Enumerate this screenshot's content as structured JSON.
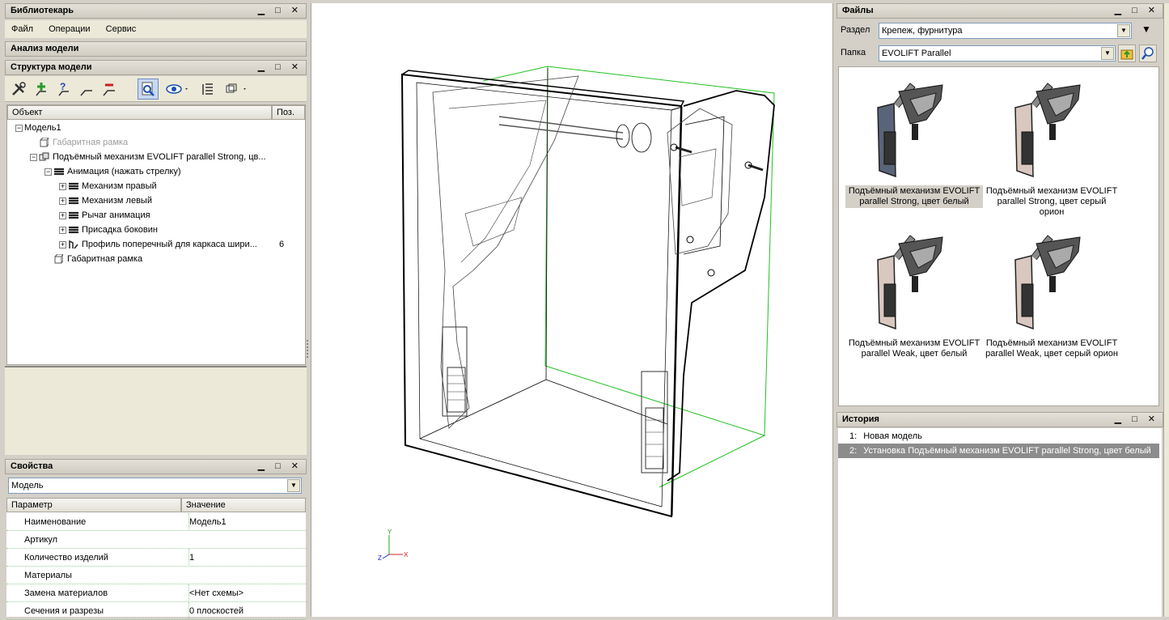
{
  "library": {
    "title": "Библиотекарь",
    "menu": [
      "Файл",
      "Операции",
      "Сервис"
    ]
  },
  "analysis": {
    "title": "Анализ модели"
  },
  "structure": {
    "title": "Структура модели",
    "columns": {
      "object": "Объект",
      "pos": "Поз."
    },
    "tree": [
      {
        "label": "Модель1",
        "level": 0,
        "expander": "−",
        "icon": "none"
      },
      {
        "label": "Габаритная рамка",
        "level": 1,
        "expander": "",
        "icon": "frame-icon",
        "dim": true
      },
      {
        "label": "Подъёмный механизм EVOLIFT parallel Strong, цв...",
        "level": 1,
        "expander": "−",
        "icon": "assembly-icon"
      },
      {
        "label": "Анимация (нажать стрелку)",
        "level": 2,
        "expander": "−",
        "icon": "stack-icon"
      },
      {
        "label": "Механизм правый",
        "level": 3,
        "expander": "+",
        "icon": "stack-icon"
      },
      {
        "label": "Механизм левый",
        "level": 3,
        "expander": "+",
        "icon": "stack-icon"
      },
      {
        "label": "Рычаг анимация",
        "level": 3,
        "expander": "+",
        "icon": "stack-icon"
      },
      {
        "label": "Присадка боковин",
        "level": 3,
        "expander": "+",
        "icon": "stack-icon"
      },
      {
        "label": "Профиль поперечный для каркаса шири...",
        "level": 3,
        "expander": "+",
        "icon": "profile-icon",
        "pos": "6"
      },
      {
        "label": "Габаритная рамка",
        "level": 2,
        "expander": "",
        "icon": "frame-icon"
      }
    ]
  },
  "properties": {
    "title": "Свойства",
    "selector": "Модель",
    "columns": {
      "param": "Параметр",
      "value": "Значение"
    },
    "rows": [
      {
        "param": "Наименование",
        "value": "Модель1"
      },
      {
        "param": "Артикул",
        "value": ""
      },
      {
        "param": "Количество изделий",
        "value": "1"
      },
      {
        "param": "Материалы",
        "value": ""
      },
      {
        "param": "Замена материалов",
        "value": "<Нет схемы>"
      },
      {
        "param": "Сечения и разрезы",
        "value": "0 плоскостей"
      }
    ]
  },
  "viewport": {
    "axes": {
      "y": "Y",
      "x": "X",
      "z": "Z"
    },
    "colors": {
      "bbox": "#22c022",
      "line": "#000000"
    }
  },
  "files": {
    "title": "Файлы",
    "section_label": "Раздел",
    "section_value": "Крепеж, фурнитура",
    "folder_label": "Папка",
    "folder_value": "EVOLIFT  Parallel",
    "items": [
      {
        "line1": "Подъёмный механизм EVOLIFT",
        "line2": "parallel Strong, цвет белый",
        "panel": "#5a6478",
        "selected": true
      },
      {
        "line1": "Подъёмный механизм EVOLIFT",
        "line2": "parallel Strong, цвет серый орион",
        "panel": "#d8c8c0",
        "selected": false
      },
      {
        "line1": "Подъёмный механизм EVOLIFT",
        "line2": "parallel Weak, цвет белый",
        "panel": "#d8c8c0",
        "selected": false
      },
      {
        "line1": "Подъёмный механизм EVOLIFT",
        "line2": "parallel Weak, цвет серый орион",
        "panel": "#d8c8c0",
        "selected": false
      }
    ]
  },
  "history": {
    "title": "История",
    "rows": [
      {
        "num": "1:",
        "text": "Новая модель"
      },
      {
        "num": "2:",
        "text": "Установка Подъёмный механизм EVOLIFT parallel Strong, цвет белый"
      }
    ]
  },
  "panel_controls": "▁ □ ✕"
}
